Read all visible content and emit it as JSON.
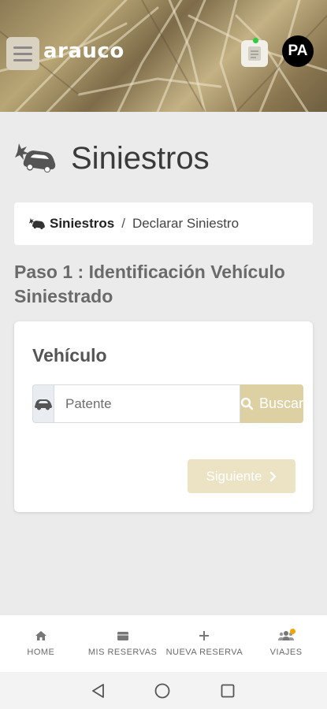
{
  "header": {
    "logo_text": "arauco",
    "avatar_initials": "PA",
    "colors": {
      "avatar_bg": "#000000",
      "notification_dot": "#2ecc40"
    }
  },
  "page": {
    "title": "Siniestros",
    "title_icon": "car-crash-icon"
  },
  "breadcrumb": {
    "items": [
      {
        "label": "Siniestros",
        "icon": "car-crash-icon"
      },
      {
        "label": "Declarar Siniestro"
      }
    ],
    "separator": "/"
  },
  "step": {
    "title": "Paso 1 : Identificación Vehículo Siniestrado"
  },
  "vehicle_card": {
    "title": "Vehículo",
    "plate_input": {
      "placeholder": "Patente",
      "value": ""
    },
    "search_button": "Buscar",
    "next_button": "Siguiente",
    "colors": {
      "accent": "#ddd1a3",
      "accent_disabled": "#ece3c4"
    }
  },
  "bottom_nav": {
    "items": [
      {
        "label": "HOME",
        "icon": "home-icon"
      },
      {
        "label": "MIS RESERVAS",
        "icon": "card-icon"
      },
      {
        "label": "NUEVA RESERVA",
        "icon": "plus-icon"
      },
      {
        "label": "VIAJES",
        "icon": "users-icon",
        "badge_color": "#f0a500"
      }
    ]
  },
  "system_nav": {
    "items": [
      {
        "icon": "back-triangle-icon"
      },
      {
        "icon": "home-circle-icon"
      },
      {
        "icon": "recents-square-icon"
      }
    ]
  }
}
